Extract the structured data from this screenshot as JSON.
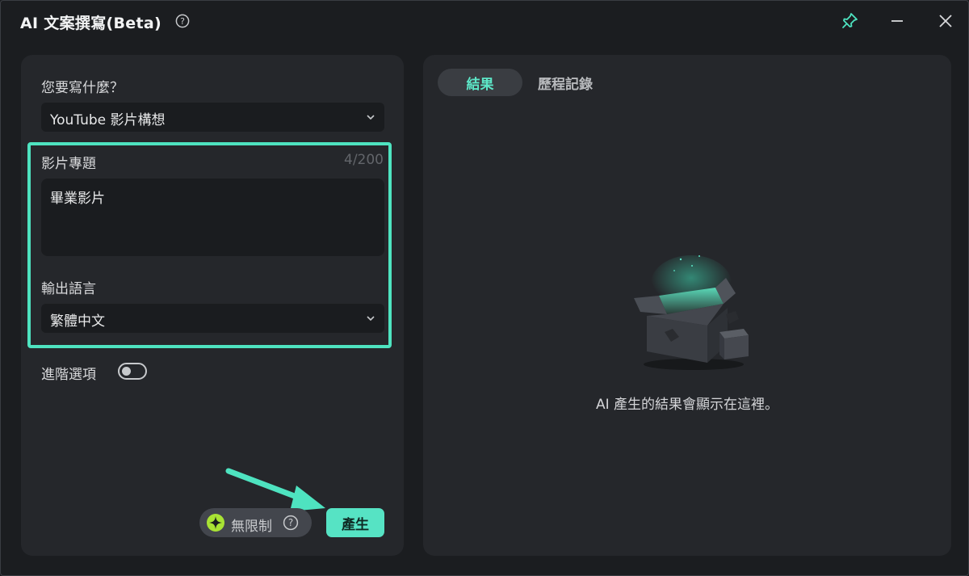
{
  "window": {
    "title": "AI 文案撰寫(Beta)"
  },
  "left": {
    "prompt_label": "您要寫什麼？",
    "type_select_value": "YouTube 影片構想",
    "topic_label": "影片專題",
    "topic_counter": "4/200",
    "topic_value": "畢業影片",
    "lang_label": "輸出語言",
    "lang_select_value": "繁體中文",
    "advanced_label": "進階選項",
    "advanced_enabled": false,
    "credit_label": "無限制",
    "generate_label": "產生"
  },
  "right": {
    "tabs": [
      {
        "label": "結果",
        "active": true
      },
      {
        "label": "歷程記錄",
        "active": false
      }
    ],
    "empty_message": "AI 產生的結果會顯示在這裡。"
  },
  "colors": {
    "accent": "#56e3c4",
    "highlight_border": "#4ee3c0",
    "background": "#1b1d20",
    "panel": "#25272b"
  },
  "icons": {
    "help": "question-circle-icon",
    "pin": "pin-icon",
    "minimize": "minimize-icon",
    "close": "close-icon",
    "chevron": "chevron-down-icon",
    "spark": "spark-icon",
    "empty_box": "open-box-illustration"
  }
}
